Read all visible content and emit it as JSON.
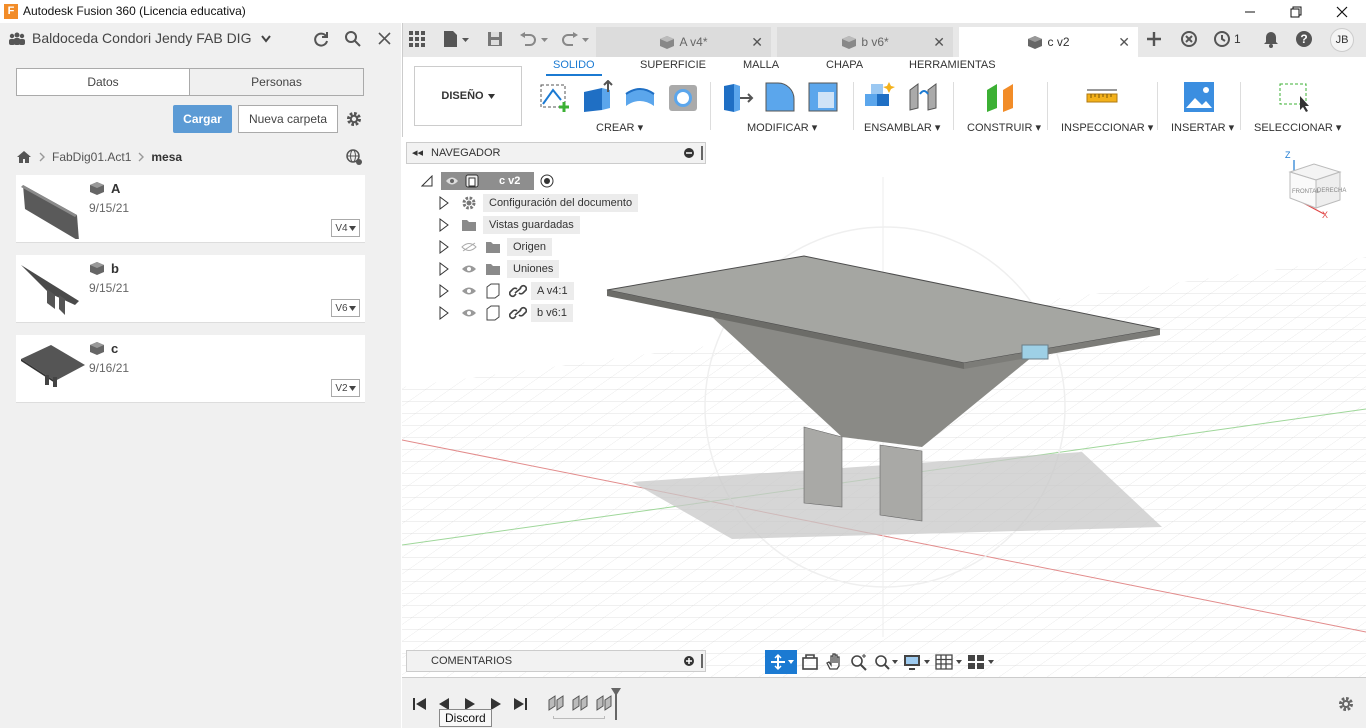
{
  "window": {
    "title": "Autodesk Fusion 360 (Licencia educativa)"
  },
  "data_panel": {
    "team": "Baldoceda Condori Jendy FAB DIG",
    "tabs": [
      "Datos",
      "Personas"
    ],
    "upload_label": "Cargar",
    "new_folder_label": "Nueva carpeta",
    "breadcrumb": [
      "FabDig01.Act1",
      "mesa"
    ],
    "files": [
      {
        "name": "A",
        "date": "9/15/21",
        "version": "V4"
      },
      {
        "name": "b",
        "date": "9/15/21",
        "version": "V6"
      },
      {
        "name": "c",
        "date": "9/16/21",
        "version": "V2"
      }
    ]
  },
  "doc_tabs": [
    {
      "label": "A v4*",
      "active": false
    },
    {
      "label": "b v6*",
      "active": false
    },
    {
      "label": "c v2",
      "active": true
    }
  ],
  "toolbar": {
    "jobs_count": "1",
    "user_initials": "JB"
  },
  "ribbon": {
    "workspace": "DISEÑO",
    "tabs": [
      "SOLIDO",
      "SUPERFICIE",
      "MALLA",
      "CHAPA",
      "HERRAMIENTAS"
    ],
    "groups": [
      "CREAR",
      "MODIFICAR",
      "ENSAMBLAR",
      "CONSTRUIR",
      "INSPECCIONAR",
      "INSERTAR",
      "SELECCIONAR"
    ]
  },
  "browser": {
    "title": "NAVEGADOR",
    "root": "c v2",
    "nodes": [
      "Configuración del documento",
      "Vistas guardadas",
      "Origen",
      "Uniones",
      "A v4:1",
      "b v6:1"
    ]
  },
  "viewcube": {
    "front": "FRONTAL",
    "right": "DERECHA",
    "axis_z": "Z",
    "axis_x": "X"
  },
  "comments": {
    "label": "COMENTARIOS"
  },
  "tooltip": {
    "text": "Discord"
  },
  "colors": {
    "accent": "#1b7ad2",
    "upload": "#5c9bd5",
    "app_icon": "#f28c28"
  }
}
